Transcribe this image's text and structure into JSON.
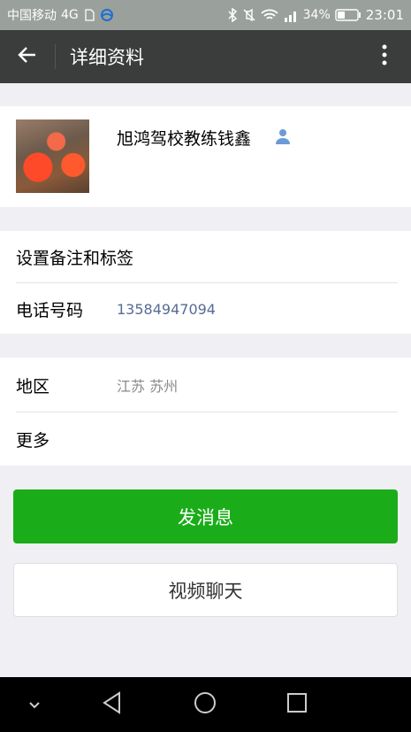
{
  "status_bar": {
    "carrier": "中国移动",
    "network": "4G",
    "battery": "34%",
    "time": "23:01",
    "icons": [
      "sim-icon",
      "china-mobile-icon",
      "bluetooth-icon",
      "mute-icon",
      "wifi-icon",
      "signal-4g-icon",
      "battery-icon"
    ]
  },
  "header": {
    "title": "详细资料",
    "back_icon": "back-arrow-icon",
    "more_icon": "more-vertical-icon"
  },
  "profile": {
    "name": "旭鸿驾校教练钱鑫",
    "avatar_icon": "avatar-image",
    "badge_icon": "contact-person-icon"
  },
  "section1": {
    "remark_label": "设置备注和标签",
    "phone_label": "电话号码",
    "phone_value": "13584947094"
  },
  "section2": {
    "region_label": "地区",
    "region_value": "江苏  苏州",
    "more_label": "更多"
  },
  "actions": {
    "send_message": "发消息",
    "video_chat": "视频聊天"
  },
  "colors": {
    "accent_green": "#1aad19",
    "header_bg": "#3b3d3c",
    "phone_link": "#576b95"
  },
  "nav_bar": {
    "icons": [
      "chevron-down-icon",
      "back-triangle-icon",
      "home-circle-icon",
      "recents-square-icon"
    ]
  }
}
